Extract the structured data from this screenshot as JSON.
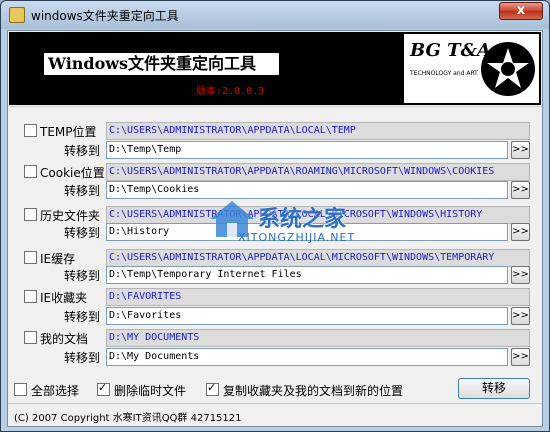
{
  "window": {
    "title": "windows文件夹重定向工具",
    "close_label": "x"
  },
  "banner": {
    "title": "Windows文件夹重定向工具",
    "version": "版本:2.0.0.3",
    "logo_text": "BG T&A",
    "logo_subtext": "TECHNOLOGY and ART"
  },
  "rows": [
    {
      "label": "TEMP位置",
      "checked": false,
      "source": "C:\\USERS\\ADMINISTRATOR\\APPDATA\\LOCAL\\TEMP",
      "target_label": "转移到",
      "target": "D:\\Temp\\Temp",
      "browse_label": ">>"
    },
    {
      "label": "Cookie位置",
      "checked": false,
      "source": "C:\\USERS\\ADMINISTRATOR\\APPDATA\\ROAMING\\MICROSOFT\\WINDOWS\\COOKIES",
      "target_label": "转移到",
      "target": "D:\\Temp\\Cookies",
      "browse_label": ">>"
    },
    {
      "label": "历史文件夹",
      "checked": false,
      "source": "C:\\USERS\\ADMINISTRATOR\\APPDATA\\LOCAL\\MICROSOFT\\WINDOWS\\HISTORY",
      "target_label": "转移到",
      "target": "D:\\History",
      "browse_label": ">>"
    },
    {
      "label": "IE缓存",
      "checked": false,
      "source": "C:\\USERS\\ADMINISTRATOR\\APPDATA\\LOCAL\\MICROSOFT\\WINDOWS\\TEMPORARY",
      "target_label": "转移到",
      "target": "D:\\Temp\\Temporary Internet Files",
      "browse_label": ">>"
    },
    {
      "label": "IE收藏夹",
      "checked": false,
      "source": "D:\\FAVORITES",
      "target_label": "转移到",
      "target": "D:\\Favorites",
      "browse_label": ">>"
    },
    {
      "label": "我的文档",
      "checked": false,
      "source": "D:\\MY DOCUMENTS",
      "target_label": "转移到",
      "target": "D:\\My Documents",
      "browse_label": ">>"
    }
  ],
  "options": {
    "select_all": {
      "label": "全部选择",
      "checked": false
    },
    "delete_temp": {
      "label": "删除临时文件",
      "checked": true
    },
    "copy_favorites": {
      "label": "复制收藏夹及我的文档到新的位置",
      "checked": true
    }
  },
  "transfer_button": "转移",
  "footer": {
    "copyright": "(C) 2007 Copyright 水寒IT资讯QQ群 42715121"
  },
  "watermark": {
    "text": "系统之家",
    "subtext": "XITONGZHIJIA.NET"
  }
}
